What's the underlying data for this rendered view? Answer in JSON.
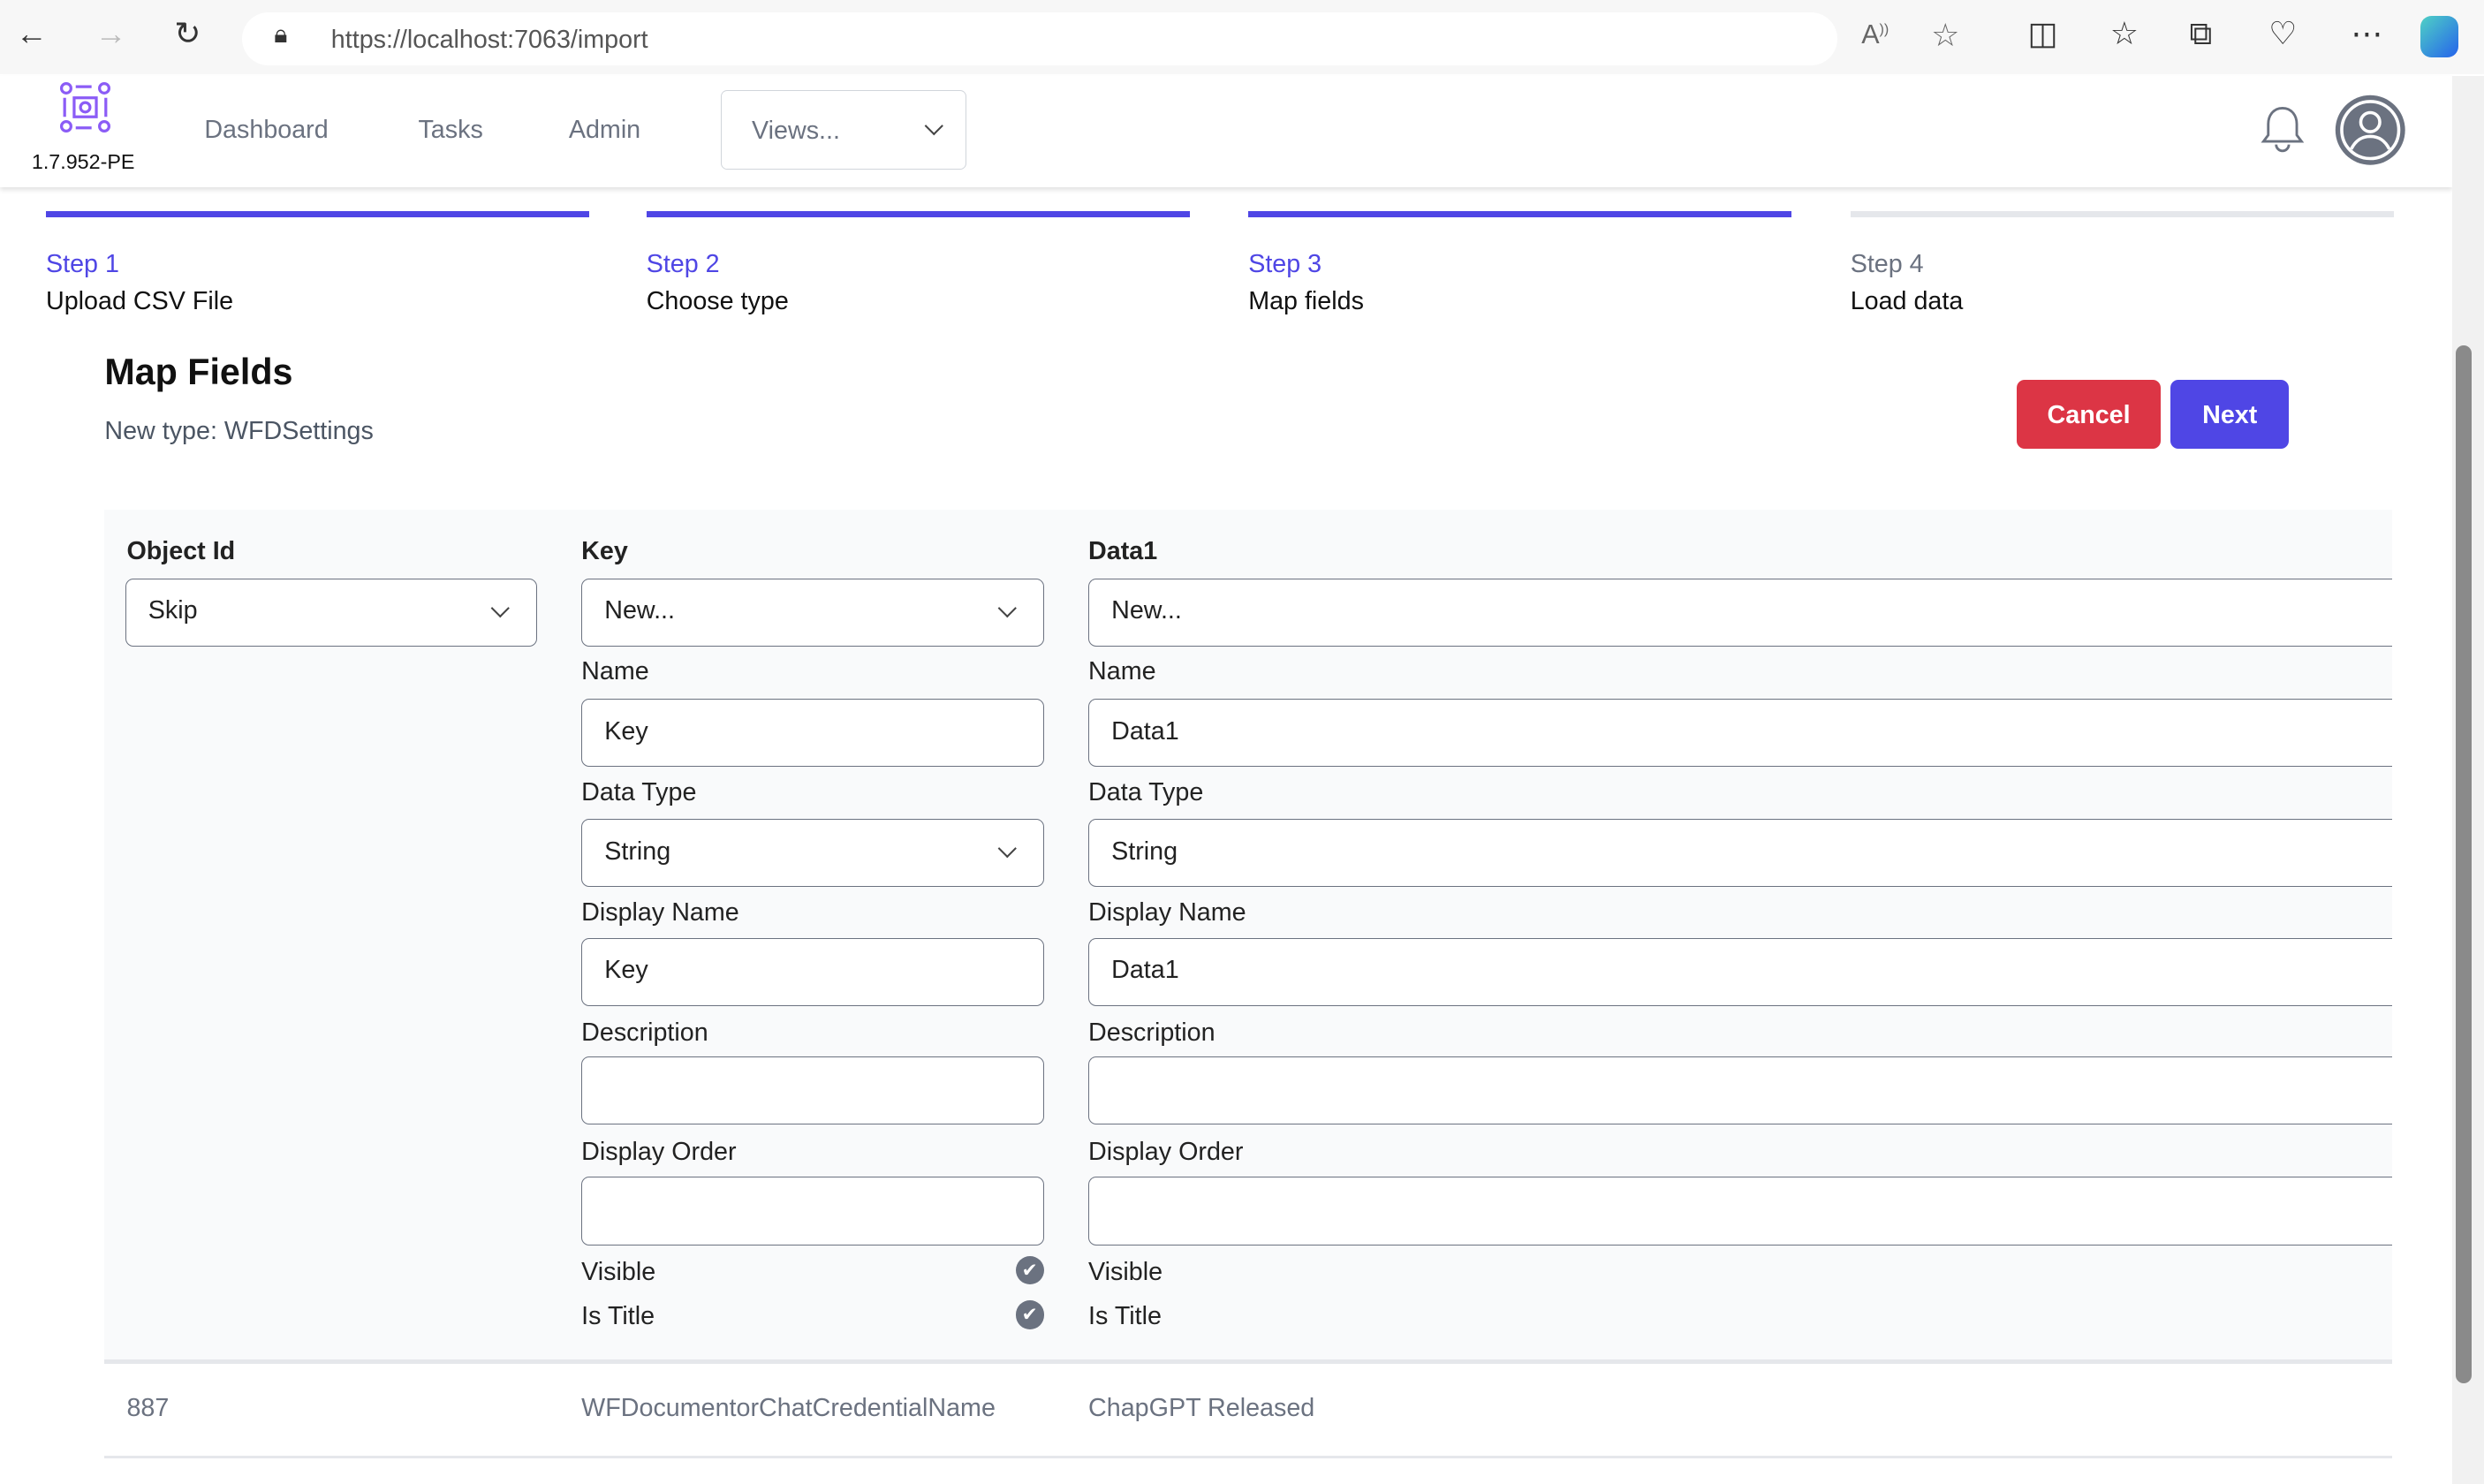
{
  "browser": {
    "url": "https://localhost:7063/import",
    "icons": [
      "back-icon",
      "forward-icon",
      "refresh-icon",
      "lock-icon",
      "read-aloud-icon",
      "favorite-star-icon",
      "split-screen-icon",
      "favorites-icon",
      "collections-icon",
      "browser-health-icon",
      "more-icon",
      "copilot-icon"
    ]
  },
  "header": {
    "version": "1.7.952-PE",
    "nav": [
      "Dashboard",
      "Tasks",
      "Admin"
    ],
    "views_label": "Views..."
  },
  "steps": [
    {
      "number": "Step 1",
      "title": "Upload CSV File",
      "complete": true
    },
    {
      "number": "Step 2",
      "title": "Choose type",
      "complete": true
    },
    {
      "number": "Step 3",
      "title": "Map fields",
      "complete": true
    },
    {
      "number": "Step 4",
      "title": "Load data",
      "complete": false
    }
  ],
  "colors": {
    "accent": "#4f46e5",
    "danger": "#dc3545",
    "inactive": "#e5e7eb"
  },
  "page": {
    "title": "Map Fields",
    "subtitle": "New type: WFDSettings",
    "cancel": "Cancel",
    "next": "Next"
  },
  "columns": [
    {
      "header": "Object Id",
      "mapping": "Skip"
    },
    {
      "header": "Key",
      "mapping": "New...",
      "name_label": "Name",
      "name": "Key",
      "type_label": "Data Type",
      "type": "String",
      "display_label": "Display Name",
      "display": "Key",
      "desc_label": "Description",
      "desc": "",
      "order_label": "Display Order",
      "order": "",
      "visible_label": "Visible",
      "visible": true,
      "title_label": "Is Title",
      "is_title": true
    },
    {
      "header": "Data1",
      "mapping": "New...",
      "name_label": "Name",
      "name": "Data1",
      "type_label": "Data Type",
      "type": "String",
      "display_label": "Display Name",
      "display": "Data1",
      "desc_label": "Description",
      "desc": "",
      "order_label": "Display Order",
      "order": "",
      "visible_label": "Visible",
      "title_label": "Is Title"
    }
  ],
  "preview_row": [
    "887",
    "WFDocumentorChatCredentialName",
    "ChapGPT Released"
  ]
}
